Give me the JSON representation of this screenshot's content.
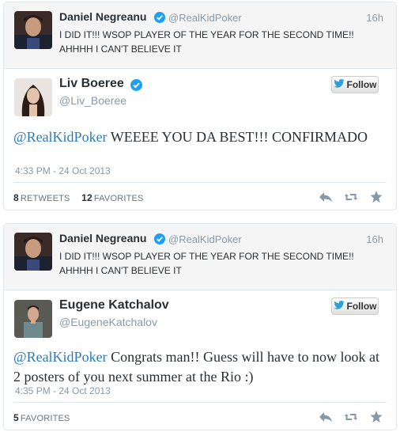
{
  "threads": [
    {
      "parent": {
        "name": "Daniel Negreanu",
        "handle": "@RealKidPoker",
        "time": "16h",
        "text_line1": "I DID IT!!! WSOP PLAYER OF THE YEAR FOR THE SECOND TIME!!",
        "text_line2": "AHHHH I CAN'T BELIEVE IT"
      },
      "reply": {
        "name": "Liv Boeree",
        "handle": "@Liv_Boeree",
        "follow_label": "Follow",
        "mention": "@RealKidPoker",
        "text": " WEEEE YOU DA BEST!!! CONFIRMADO",
        "timestamp": "4:33 PM - 24 Oct 2013",
        "retweets_count": "8",
        "retweets_label": "Retweets",
        "favorites_count": "12",
        "favorites_label": "Favorites"
      }
    },
    {
      "parent": {
        "name": "Daniel Negreanu",
        "handle": "@RealKidPoker",
        "time": "16h",
        "text_line1": "I DID IT!!! WSOP PLAYER OF THE YEAR FOR THE SECOND TIME!!",
        "text_line2": "AHHHH I CAN'T BELIEVE IT"
      },
      "reply": {
        "name": "Eugene Katchalov",
        "handle": "@EugeneKatchalov",
        "follow_label": "Follow",
        "mention": "@RealKidPoker",
        "text": " Congrats man!! Guess will have to now look at 2 posters of you next summer at the Rio :)",
        "timestamp": "4:35 PM - 24 Oct 2013",
        "favorites_count": "5",
        "favorites_label": "Favorites"
      }
    }
  ],
  "colors": {
    "link": "#2b7bb9",
    "verified": "#1da1f2",
    "muted": "#8899a6",
    "action_icon": "#8899a6"
  },
  "icons": [
    "verified-badge-icon",
    "twitter-bird-icon",
    "reply-icon",
    "retweet-icon",
    "favorite-star-icon"
  ]
}
